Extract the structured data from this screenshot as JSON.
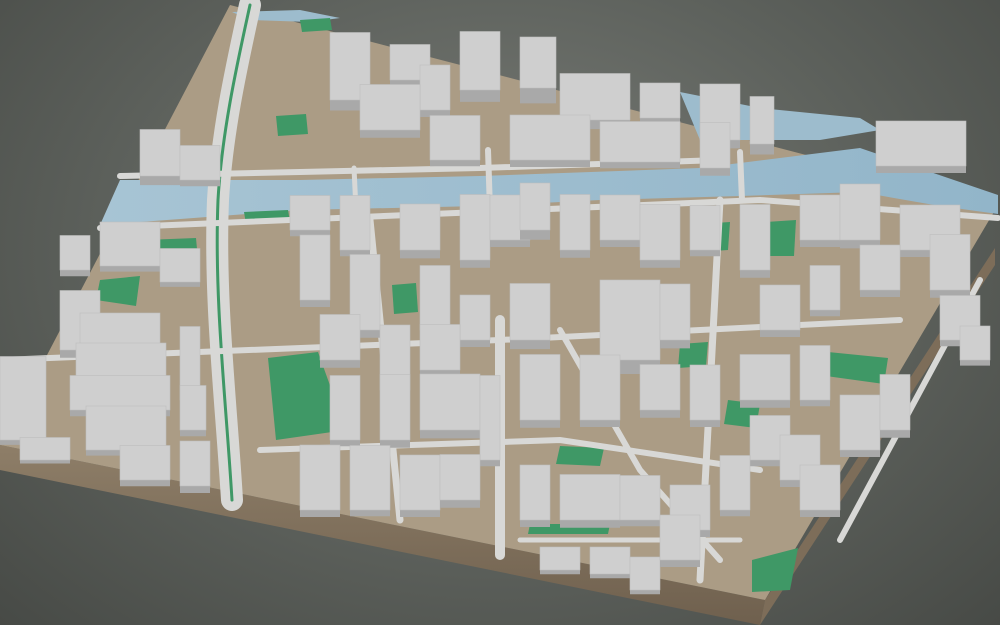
{
  "scene": {
    "kind": "3d-city-block-model",
    "colors": {
      "background": "#5d615c",
      "ground": "#ab9c85",
      "base_side": "#8d7c66",
      "base_front": "#7a6a56",
      "water": "#9dbccd",
      "park": "#3f9866",
      "road": "#d8d8d6",
      "building": "#cfcfcf",
      "building_shade": "#a9a9a9"
    },
    "layers": [
      "ground-plate",
      "river",
      "parks",
      "roads",
      "buildings"
    ]
  }
}
